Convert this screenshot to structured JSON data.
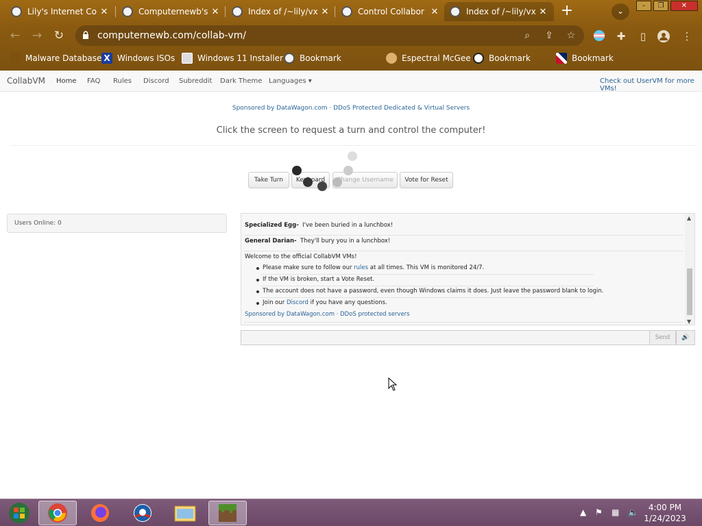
{
  "browser": {
    "tabs": [
      {
        "title": "Lily's Internet Co"
      },
      {
        "title": "Computernewb's I"
      },
      {
        "title": "Index of /~lily/vx"
      },
      {
        "title": "Control Collabor"
      },
      {
        "title": "Index of /~lily/vx"
      }
    ],
    "close_glyph": "✕",
    "new_tab_glyph": "+",
    "url": "computernewb.com/collab-vm/"
  },
  "bookmarks": [
    {
      "label": "Malware Database",
      "icon": "folder-icon"
    },
    {
      "label": "Windows ISOs",
      "icon": "x-icon"
    },
    {
      "label": "Windows 11 Installer",
      "icon": "image-icon"
    },
    {
      "label": "Bookmark",
      "icon": "site-icon"
    },
    {
      "label": "Espectral McGee",
      "icon": "avatar-icon"
    },
    {
      "label": "Bookmark",
      "icon": "avatar-icon"
    },
    {
      "label": "Bookmark",
      "icon": "flag-icon"
    }
  ],
  "site": {
    "brand": "CollabVM",
    "nav": [
      "Home",
      "FAQ",
      "Rules",
      "Discord",
      "Subreddit",
      "Dark Theme",
      "Languages"
    ],
    "uservm_link": "Check out UserVM for more VMs!",
    "sponsor": "Sponsored by DataWagon.com · DDoS Protected Dedicated & Virtual Servers",
    "headline": "Click the screen to request a turn and control the computer!",
    "buttons": {
      "take_turn": "Take Turn",
      "keyboard": "Keyboard",
      "change_username": "Change Username",
      "vote_reset": "Vote for Reset"
    },
    "users_online": "Users Online: 0"
  },
  "chat": {
    "messages": [
      {
        "user": "Specialized Egg",
        "text": "I've been buried in a lunchbox!"
      },
      {
        "user": "General Darian",
        "text": "They'll bury you in a lunchbox!"
      }
    ],
    "welcome": "Welcome to the official CollabVM VMs!",
    "rules": [
      {
        "before": "Please make sure to follow our ",
        "link": "rules",
        "after": " at all times. This VM is monitored 24/7."
      },
      {
        "before": "If the VM is broken, start a Vote Reset.",
        "link": "",
        "after": ""
      },
      {
        "before": "The account does not have a password, even though Windows claims it does. Just leave the password blank to login.",
        "link": "",
        "after": ""
      },
      {
        "before": "Join our ",
        "link": "Discord",
        "after": " if you have any questions."
      }
    ],
    "sponsor_footer": "Sponsored by DataWagon.com · DDoS protected servers",
    "send_label": "Send",
    "voice_glyph": "🔊"
  },
  "taskbar": {
    "apps": [
      "start-orb",
      "chrome",
      "firefox",
      "campaign-logo",
      "file-explorer",
      "minecraft"
    ],
    "time": "4:00 PM",
    "date": "1/24/2023"
  }
}
